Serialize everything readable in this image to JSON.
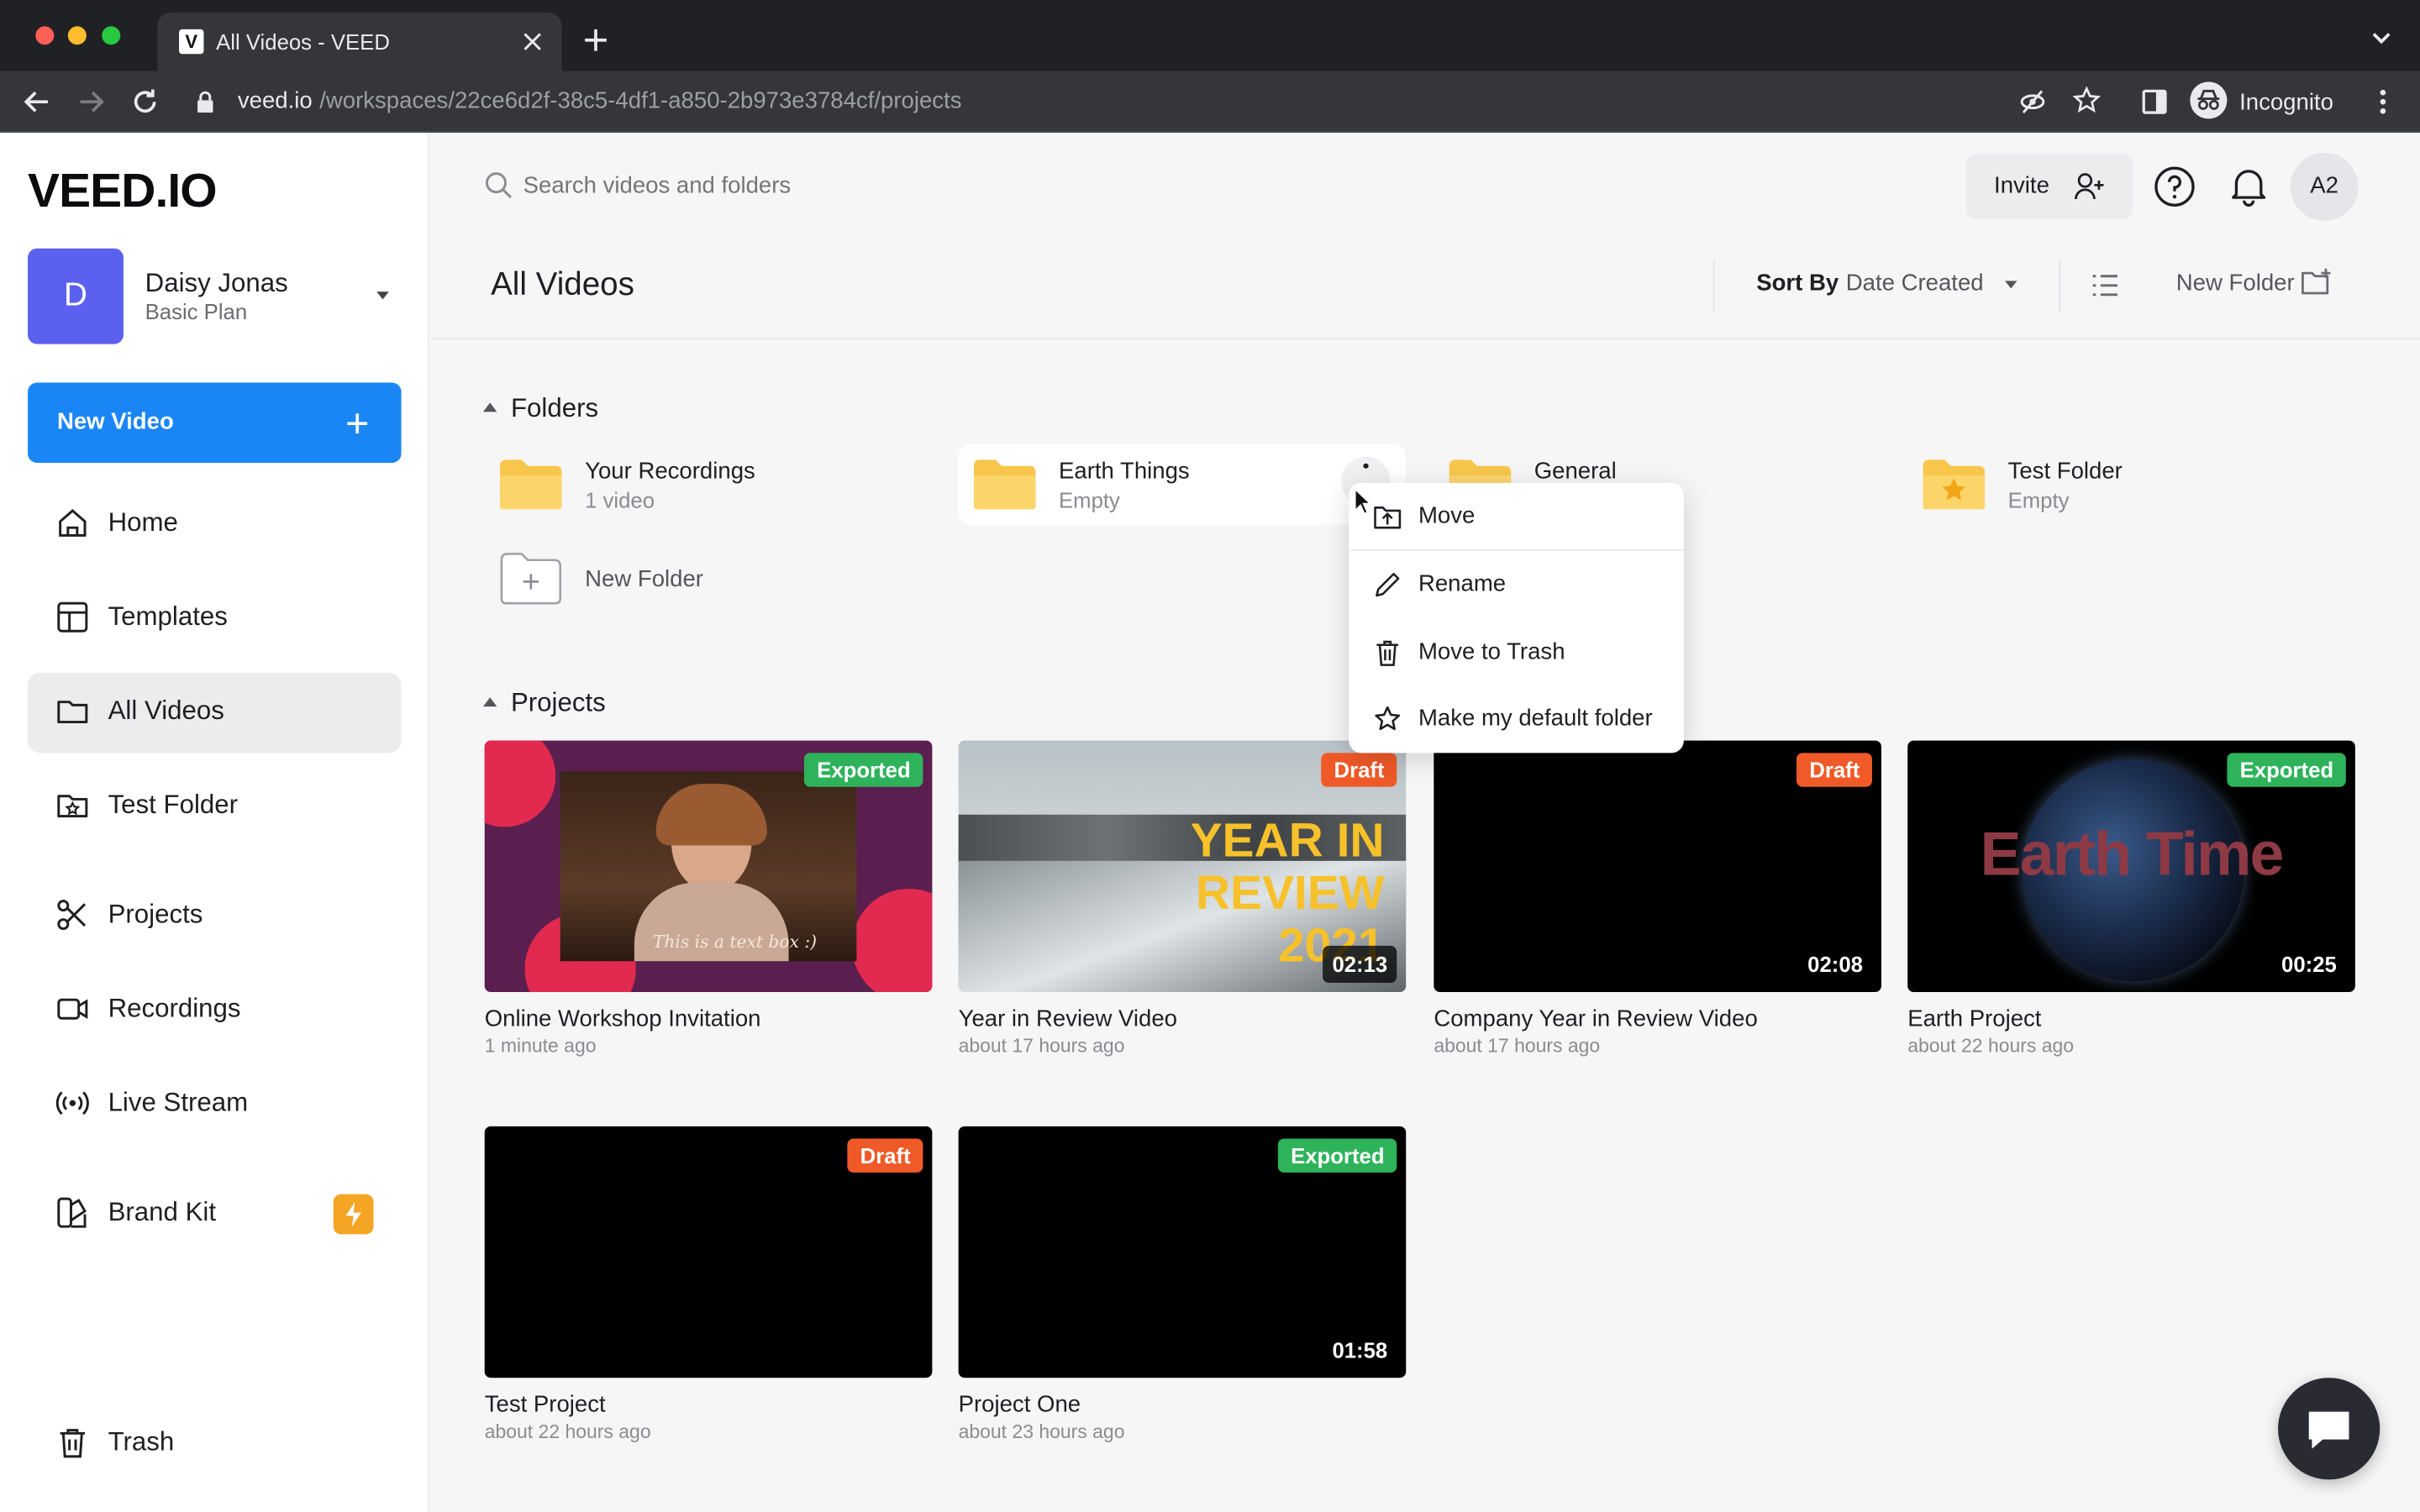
{
  "browser": {
    "tab_title": "All Videos - VEED",
    "tab_icon": "V",
    "url_domain": "veed.io",
    "url_path": "/workspaces/22ce6d2f-38c5-4df1-a850-2b973e3784cf/projects",
    "profile_label": "Incognito"
  },
  "sidebar": {
    "logo": "VEED.IO",
    "user": {
      "initial": "D",
      "name": "Daisy Jonas",
      "plan": "Basic Plan"
    },
    "new_video_label": "New Video",
    "items": [
      {
        "label": "Home",
        "icon": "home-icon"
      },
      {
        "label": "Templates",
        "icon": "templates-icon"
      },
      {
        "label": "All Videos",
        "icon": "folder-icon"
      },
      {
        "label": "Test Folder",
        "icon": "folder-star-icon"
      },
      {
        "label": "Projects",
        "icon": "scissors-icon"
      },
      {
        "label": "Recordings",
        "icon": "camera-icon"
      },
      {
        "label": "Live Stream",
        "icon": "broadcast-icon"
      },
      {
        "label": "Brand Kit",
        "icon": "brand-kit-icon"
      }
    ],
    "trash_label": "Trash"
  },
  "topbar": {
    "search_placeholder": "Search videos and folders",
    "invite_label": "Invite",
    "avatar_label": "A2"
  },
  "header": {
    "title": "All Videos",
    "sort_by_label": "Sort By",
    "sort_value": "Date Created",
    "new_folder_label": "New Folder"
  },
  "folders": {
    "section_label": "Folders",
    "items": [
      {
        "name": "Your Recordings",
        "meta": "1 video"
      },
      {
        "name": "Earth Things",
        "meta": "Empty"
      },
      {
        "name": "General",
        "meta": ""
      },
      {
        "name": "Test Folder",
        "meta": "Empty"
      }
    ],
    "new_folder_label": "New Folder"
  },
  "context_menu": {
    "items": [
      {
        "label": "Move",
        "icon": "move-folder-icon"
      },
      {
        "label": "Rename",
        "icon": "pencil-icon"
      },
      {
        "label": "Move to Trash",
        "icon": "trash-icon"
      },
      {
        "label": "Make my default folder",
        "icon": "star-icon"
      }
    ]
  },
  "projects": {
    "section_label": "Projects",
    "items": [
      {
        "title": "Online Workshop Invitation",
        "time": "1 minute ago",
        "status": "Exported",
        "duration": "",
        "caption": "This is a text box :)"
      },
      {
        "title": "Year in Review Video",
        "time": "about 17 hours ago",
        "status": "Draft",
        "duration": "02:13",
        "overlay_line1": "YEAR IN",
        "overlay_line2": "REVIEW",
        "overlay_line3": "2021"
      },
      {
        "title": "Company Year in Review Video",
        "time": "about 17 hours ago",
        "status": "Draft",
        "duration": "02:08"
      },
      {
        "title": "Earth Project",
        "time": "about 22 hours ago",
        "status": "Exported",
        "duration": "00:25",
        "overlay": "Earth Time"
      },
      {
        "title": "Test Project",
        "time": "about 22 hours ago",
        "status": "Draft",
        "duration": ""
      },
      {
        "title": "Project One",
        "time": "about 23 hours ago",
        "status": "Exported",
        "duration": "01:58"
      }
    ]
  },
  "colors": {
    "accent": "#1a86f5",
    "exported": "#2eb35b",
    "draft": "#f05a28",
    "brand_kit_badge": "#f5a524"
  }
}
